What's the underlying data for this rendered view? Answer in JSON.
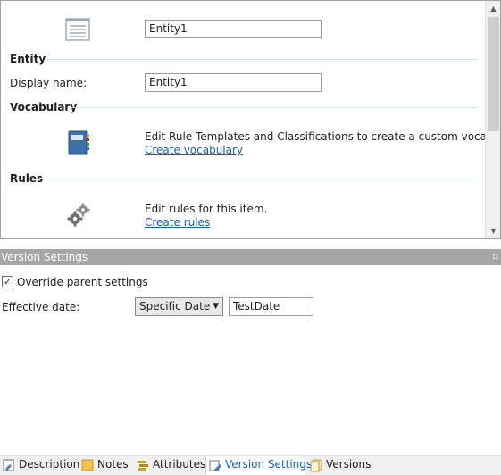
{
  "header": {
    "name_value": "Entity1"
  },
  "entity": {
    "title": "Entity",
    "display_name_label": "Display name:",
    "display_name_value": "Entity1"
  },
  "vocabulary": {
    "title": "Vocabulary",
    "description": "Edit Rule Templates and Classifications to create a custom vocabulary.",
    "link": "Create vocabulary"
  },
  "rules": {
    "title": "Rules",
    "description": "Edit rules for this item.",
    "link": "Create rules"
  },
  "version_settings": {
    "title": "Version Settings",
    "override_label": "Override parent settings",
    "override_checked": true,
    "effective_date_label": "Effective date:",
    "effective_date_mode": "Specific Date",
    "effective_date_value": "TestDate"
  },
  "tabs": [
    {
      "label": "Description",
      "icon": "description-icon"
    },
    {
      "label": "Notes",
      "icon": "notes-icon"
    },
    {
      "label": "Attributes",
      "icon": "attributes-icon"
    },
    {
      "label": "Version Settings",
      "icon": "version-settings-icon",
      "active": true
    },
    {
      "label": "Versions",
      "icon": "versions-icon"
    }
  ],
  "colors": {
    "link": "#1a5fb4",
    "section_rule": "#cfe4ef",
    "header_bar": "#a6a6a6"
  }
}
